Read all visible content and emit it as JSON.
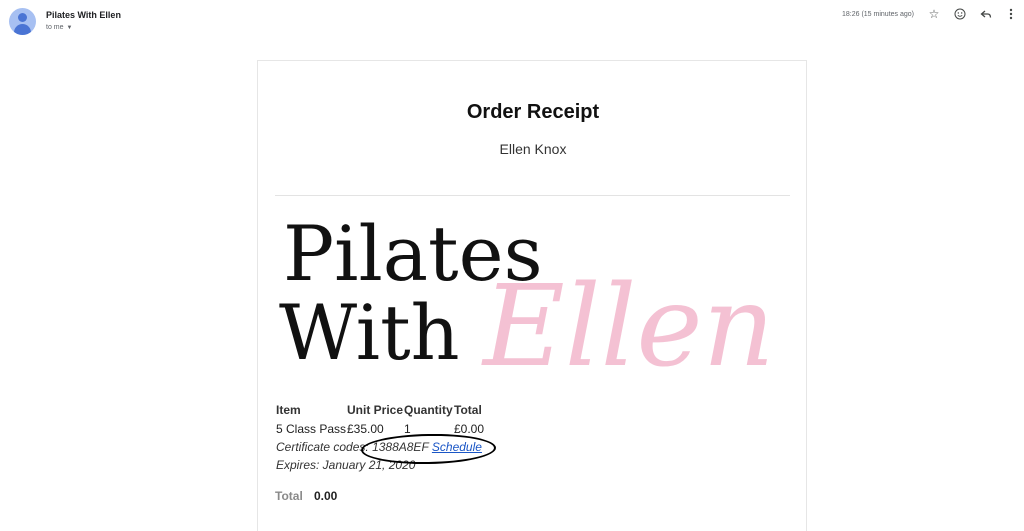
{
  "email": {
    "sender": "Pilates With Ellen",
    "recipient": "to me",
    "timestamp": "18:26 (15 minutes ago)"
  },
  "icons": [
    "star-icon",
    "emoji-icon",
    "reply-icon",
    "more-vert-icon",
    "caret-down-icon",
    "avatar-person-icon"
  ],
  "receipt": {
    "title": "Order Receipt",
    "customer": "Ellen Knox",
    "logo": {
      "line1": "Pilates",
      "line2": "With",
      "script": "Ellen"
    },
    "table": {
      "headers": [
        "Item",
        "Unit Price",
        "Quantity",
        "Total"
      ],
      "row": {
        "item": "5 Class Pass",
        "unit_price": "£35.00",
        "quantity": "1",
        "total": "£0.00"
      },
      "certificate_label": "Certificate codes:",
      "certificate_code": "1388A8EF",
      "schedule_link": "Schedule",
      "expires": "Expires: January 21, 2020"
    },
    "total_label": "Total",
    "total_value": "0.00"
  },
  "colors": {
    "logo_pink": "#f2b6cb",
    "link_blue": "#1a56c6",
    "avatar_blue": "#a7c0f2"
  }
}
